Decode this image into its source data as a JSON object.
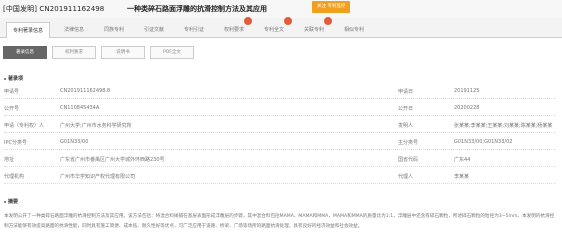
{
  "header": {
    "doc_id": "[中国发明] CN201911162498",
    "title": "一种类碎石路面浮雕的抗滑控制方法及其应用",
    "follow_label": "关注  专利监控"
  },
  "tabs": [
    {
      "label": "专利著录信息",
      "active": true,
      "marked": false
    },
    {
      "label": "法律信息",
      "active": false,
      "marked": false
    },
    {
      "label": "同族专利",
      "active": false,
      "marked": false
    },
    {
      "label": "引证文献",
      "active": false,
      "marked": false
    },
    {
      "label": "专利引证",
      "active": false,
      "marked": false
    },
    {
      "label": "权利要求",
      "active": false,
      "marked": true
    },
    {
      "label": "专利全文",
      "active": false,
      "marked": true
    },
    {
      "label": "关联专利",
      "active": false,
      "marked": true
    },
    {
      "label": "相似专利",
      "active": false,
      "marked": false
    }
  ],
  "subtabs": [
    {
      "label": "著录信息",
      "active": true
    },
    {
      "label": "权利要求",
      "active": false
    },
    {
      "label": "说明书",
      "active": false
    },
    {
      "label": "PDF全文",
      "active": false
    }
  ],
  "biblio": {
    "section_title": "著录项",
    "rows": [
      {
        "l1": "申请号",
        "v1": "CN201911162498.8",
        "l2": "申请日",
        "v2": "20191125"
      },
      {
        "l1": "公开号",
        "v1": "CN110845434A",
        "l2": "公开日",
        "v2": "20200228"
      },
      {
        "l1": "申请（专利权）人",
        "v1": "广州大学;广州市水务科学研究所",
        "l2": "发明人",
        "v2": "张某某;李某某;王某某;刘某某;陈某某;杨某某"
      },
      {
        "l1": "IPC分类号",
        "v1": "G01N33/00",
        "l2": "主分类号",
        "v2": "G01N33/00;G01N33/02"
      },
      {
        "l1": "地址",
        "v1": "广东省广州市番禺区广州大学城外环西路230号",
        "l2": "国省代码",
        "v2": "广东44"
      },
      {
        "l1": "代理机构",
        "v1": "广州市华学知识产权代理有限公司",
        "l2": "代理人",
        "v2": "李某某"
      }
    ]
  },
  "abstract": {
    "section_title": "摘要",
    "text": "本发明公开了一种类碎石路面浮雕的抗滑控制方法及其应用。该方法包括：将混合料摊铺在基层表面形成浮雕层的步骤，其中混合料包括MAMA、MAMA和MMA，MAMA和MMA的质量比为1:1，浮雕层中还含有碎石颗粒，所述碎石颗粒的粒径为3~5mm。本发明的抗滑控制方法能够有效提高路面的抗滑性能，同时具有施工简便、成本低、耐久性好等优点，可广泛应用于道路、桥梁、广场等场所的路面抗滑处理，具有良好的经济效益和社会效益。"
  }
}
